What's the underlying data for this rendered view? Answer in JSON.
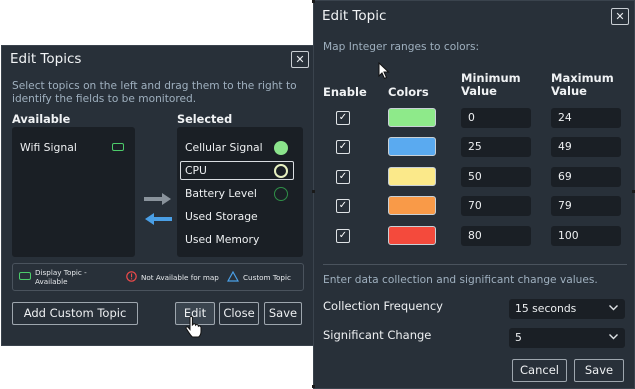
{
  "edit_topics": {
    "title": "Edit Topics",
    "instructions": "Select topics on the left and drag them to the right to identify the fields to be monitored.",
    "available_header": "Available",
    "selected_header": "Selected",
    "available": [
      {
        "label": "Wifi Signal",
        "indicator": "display-topic-rect",
        "color": "#4ccb6a"
      }
    ],
    "selected": [
      {
        "label": "Cellular Signal",
        "indicator": "filled-circle",
        "color": "#8be38c"
      },
      {
        "label": "CPU",
        "indicator": "ring-circle",
        "color": "#e6f0c0"
      },
      {
        "label": "Battery Level",
        "indicator": "outline-circle",
        "color": "#2f8f48"
      },
      {
        "label": "Used Storage"
      },
      {
        "label": "Used Memory"
      }
    ],
    "legend": {
      "display_topic": "Display Topic - Available",
      "not_available": "Not Available for map",
      "custom_topic": "Custom Topic"
    },
    "buttons": {
      "add_custom": "Add Custom Topic",
      "edit": "Edit",
      "close": "Close",
      "save": "Save"
    }
  },
  "edit_topic": {
    "title": "Edit Topic",
    "map_hint": "Map Integer ranges to colors:",
    "columns": {
      "enable": "Enable",
      "colors": "Colors",
      "minimum": "Minimum Value",
      "maximum": "Maximum Value"
    },
    "ranges": [
      {
        "enabled": true,
        "color": "#8eea8a",
        "min": "0",
        "max": "24"
      },
      {
        "enabled": true,
        "color": "#5aaaf0",
        "min": "25",
        "max": "49"
      },
      {
        "enabled": true,
        "color": "#fbe98a",
        "min": "50",
        "max": "69"
      },
      {
        "enabled": true,
        "color": "#f99a48",
        "min": "70",
        "max": "79"
      },
      {
        "enabled": true,
        "color": "#f44a3c",
        "min": "80",
        "max": "100"
      }
    ],
    "collection_hint": "Enter data collection and significant change values.",
    "collection_frequency_label": "Collection Frequency",
    "collection_frequency_value": "15 seconds",
    "significant_change_label": "Significant Change",
    "significant_change_value": "5",
    "buttons": {
      "cancel": "Cancel",
      "save": "Save"
    }
  }
}
